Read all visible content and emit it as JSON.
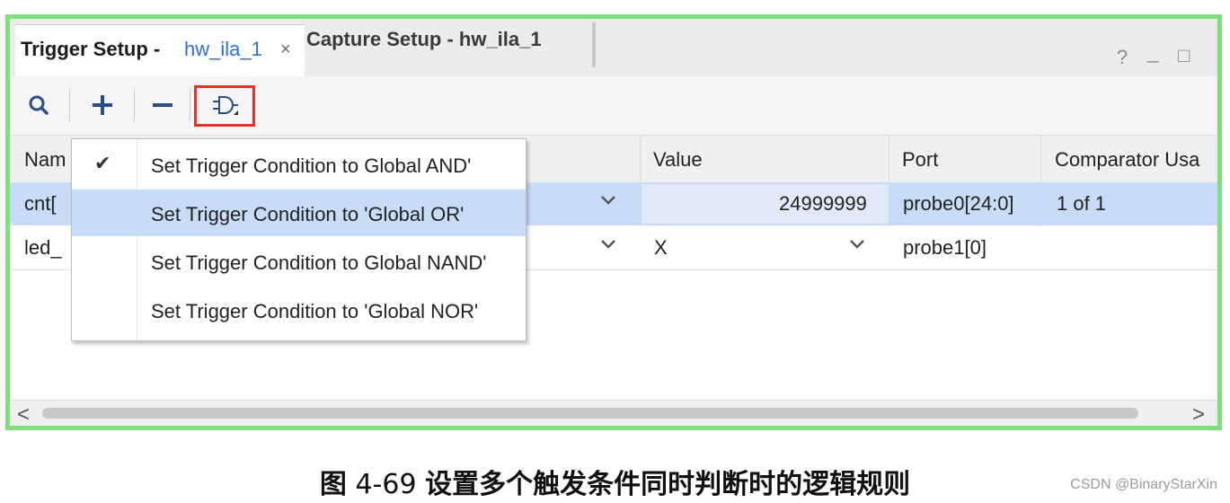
{
  "tabs": {
    "active_title": "Trigger Setup -",
    "active_sub": "hw_ila_1",
    "close_glyph": "×",
    "inactive_title": "Capture Setup - hw_ila_1"
  },
  "window_controls": {
    "help": "?",
    "minimize": "_",
    "maximize": "□"
  },
  "toolbar": {
    "search_icon": "magnifier-icon",
    "add_icon": "plus-icon",
    "remove_icon": "minus-icon",
    "condition_icon": "logic-gate-icon"
  },
  "table": {
    "columns": [
      "Nam",
      "Value",
      "Port",
      "Comparator Usa"
    ],
    "rows": [
      {
        "name": "cnt[",
        "value": "24999999",
        "port": "probe0[24:0]",
        "comparator": "1 of 1",
        "selected": true
      },
      {
        "name": "led_",
        "value": "X",
        "port": "probe1[0]",
        "comparator": "",
        "selected": false
      }
    ]
  },
  "menu": {
    "items": [
      {
        "label": "Set Trigger Condition to Global AND'",
        "checked": true
      },
      {
        "label": "Set Trigger Condition to 'Global OR'",
        "checked": false,
        "hover": true
      },
      {
        "label": "Set Trigger Condition to Global NAND'",
        "checked": false
      },
      {
        "label": "Set Trigger Condition to 'Global NOR'",
        "checked": false
      }
    ],
    "check_glyph": "✔"
  },
  "scrollbar": {
    "left": "<",
    "right": ">"
  },
  "caption": {
    "figure": "图",
    "number": "4-69",
    "text": "设置多个触发条件同时判断时的逻辑规则"
  },
  "watermark": "CSDN @BinaryStarXin",
  "colors": {
    "frame": "#7ee07a",
    "highlight": "#e0332e",
    "selection": "#c9dcf7",
    "link": "#2f6fd6"
  }
}
